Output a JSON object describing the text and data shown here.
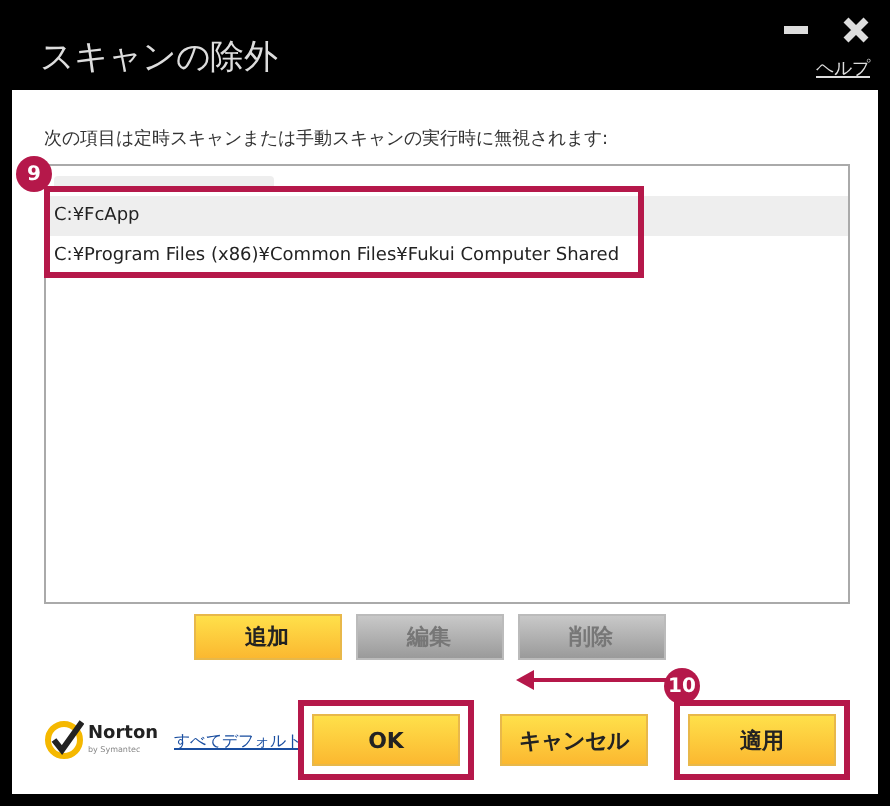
{
  "window": {
    "title": "スキャンの除外",
    "help_link": "ヘルプ"
  },
  "description": "次の項目は定時スキャンまたは手動スキャンの実行時に無視されます:",
  "exclusions": [
    {
      "path": "C:¥FcApp",
      "selected": true
    },
    {
      "path": "C:¥Program Files (x86)¥Common Files¥Fukui Computer Shared",
      "selected": false
    }
  ],
  "list_buttons": [
    {
      "label": "追加",
      "disabled": false
    },
    {
      "label": "編集",
      "disabled": true
    },
    {
      "label": "削除",
      "disabled": true
    }
  ],
  "logo": {
    "name": "Norton",
    "tagline": "by Symantec"
  },
  "reset_link": "すべてデフォルト",
  "dialog_buttons": [
    {
      "label": "OK",
      "highlighted": true
    },
    {
      "label": "キャンセル",
      "highlighted": false
    },
    {
      "label": "適用",
      "highlighted": true
    }
  ],
  "annotations": [
    {
      "label": "9"
    },
    {
      "label": "10"
    }
  ]
}
